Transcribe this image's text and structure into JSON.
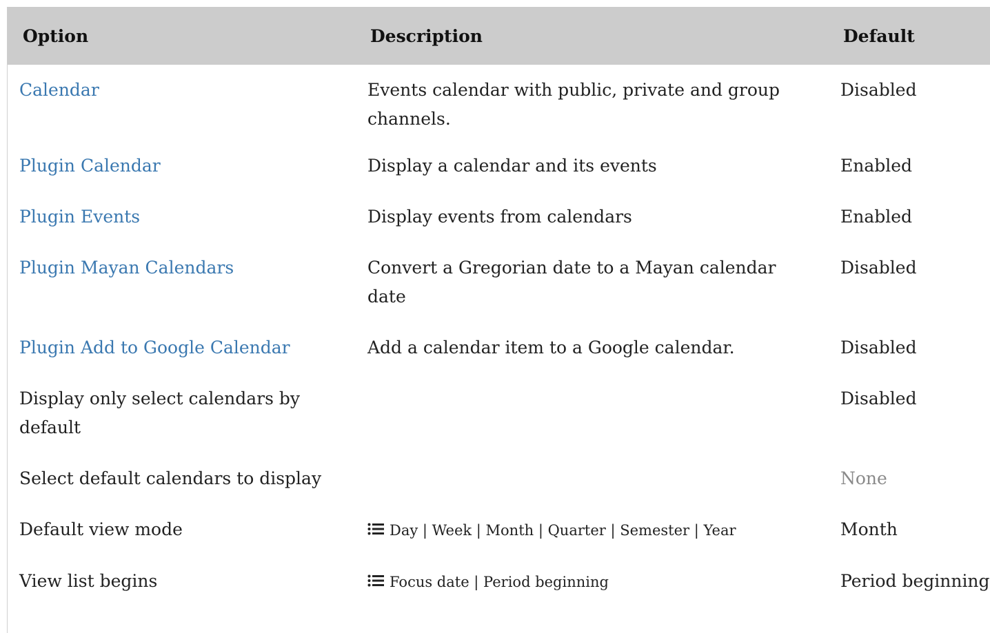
{
  "headers": {
    "option": "Option",
    "description": "Description",
    "default": "Default"
  },
  "rows": [
    {
      "option": "Calendar",
      "option_link": true,
      "description": "Events calendar with public, private and group channels.",
      "default": "Disabled"
    },
    {
      "option": "Plugin Calendar",
      "option_link": true,
      "description": "Display a calendar and its events",
      "default": "Enabled"
    },
    {
      "option": "Plugin Events",
      "option_link": true,
      "description": "Display events from calendars",
      "default": "Enabled"
    },
    {
      "option": "Plugin Mayan Calendars",
      "option_link": true,
      "description": "Convert a Gregorian date to a Mayan calendar date",
      "default": "Disabled"
    },
    {
      "option": "Plugin Add to Google Calendar",
      "option_link": true,
      "description": "Add a calendar item to a Google calendar.",
      "default": "Disabled"
    },
    {
      "option": "Display only select calendars by default",
      "option_link": false,
      "description": "",
      "default": "Disabled"
    },
    {
      "option": "Select default calendars to display",
      "option_link": false,
      "description": "",
      "default": "None"
    },
    {
      "option": "Default view mode",
      "option_link": false,
      "description": "Day | Week | Month | Quarter | Semester | Year",
      "description_icon": "list-icon",
      "default": "Month"
    },
    {
      "option": "View list begins",
      "option_link": false,
      "description": "Focus date | Period beginning",
      "description_icon": "list-icon",
      "default": "Period beginning"
    }
  ],
  "colors": {
    "header_bg": "#cccccc",
    "link": "#3a78b0",
    "muted": "#8a8a8a"
  }
}
